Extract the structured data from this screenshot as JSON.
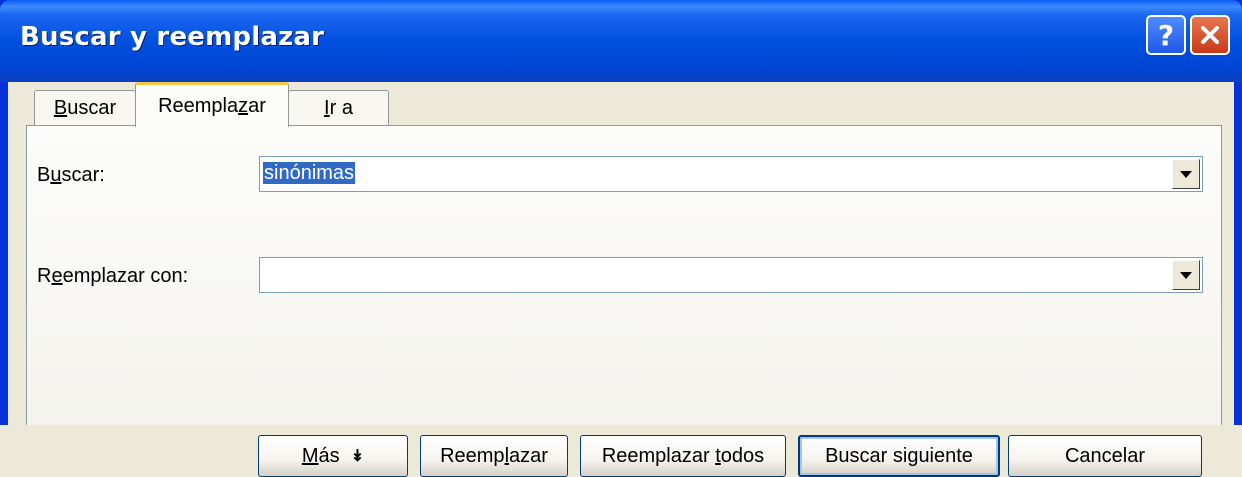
{
  "window": {
    "title": "Buscar y reemplazar",
    "help_label": "?",
    "close_label": "✕"
  },
  "tabs": [
    {
      "label": "Buscar",
      "mnemonic_index": 0,
      "active": false
    },
    {
      "label": "Reemplazar",
      "mnemonic_index": 8,
      "active": true
    },
    {
      "label": "Ir a",
      "mnemonic_index": 0,
      "active": false
    }
  ],
  "find": {
    "label": "Buscar:",
    "value": "sinónimas"
  },
  "replace": {
    "label": "Reemplazar con:",
    "value": ""
  },
  "buttons": {
    "more": "Más",
    "more_arrow": "↡",
    "replace": "Reemplazar",
    "replace_all": "Reemplazar todos",
    "find_next": "Buscar siguiente",
    "cancel": "Cancelar"
  },
  "colors": {
    "titlebar": "#0054e3",
    "selection": "#316ac5",
    "face": "#ece9d8"
  }
}
